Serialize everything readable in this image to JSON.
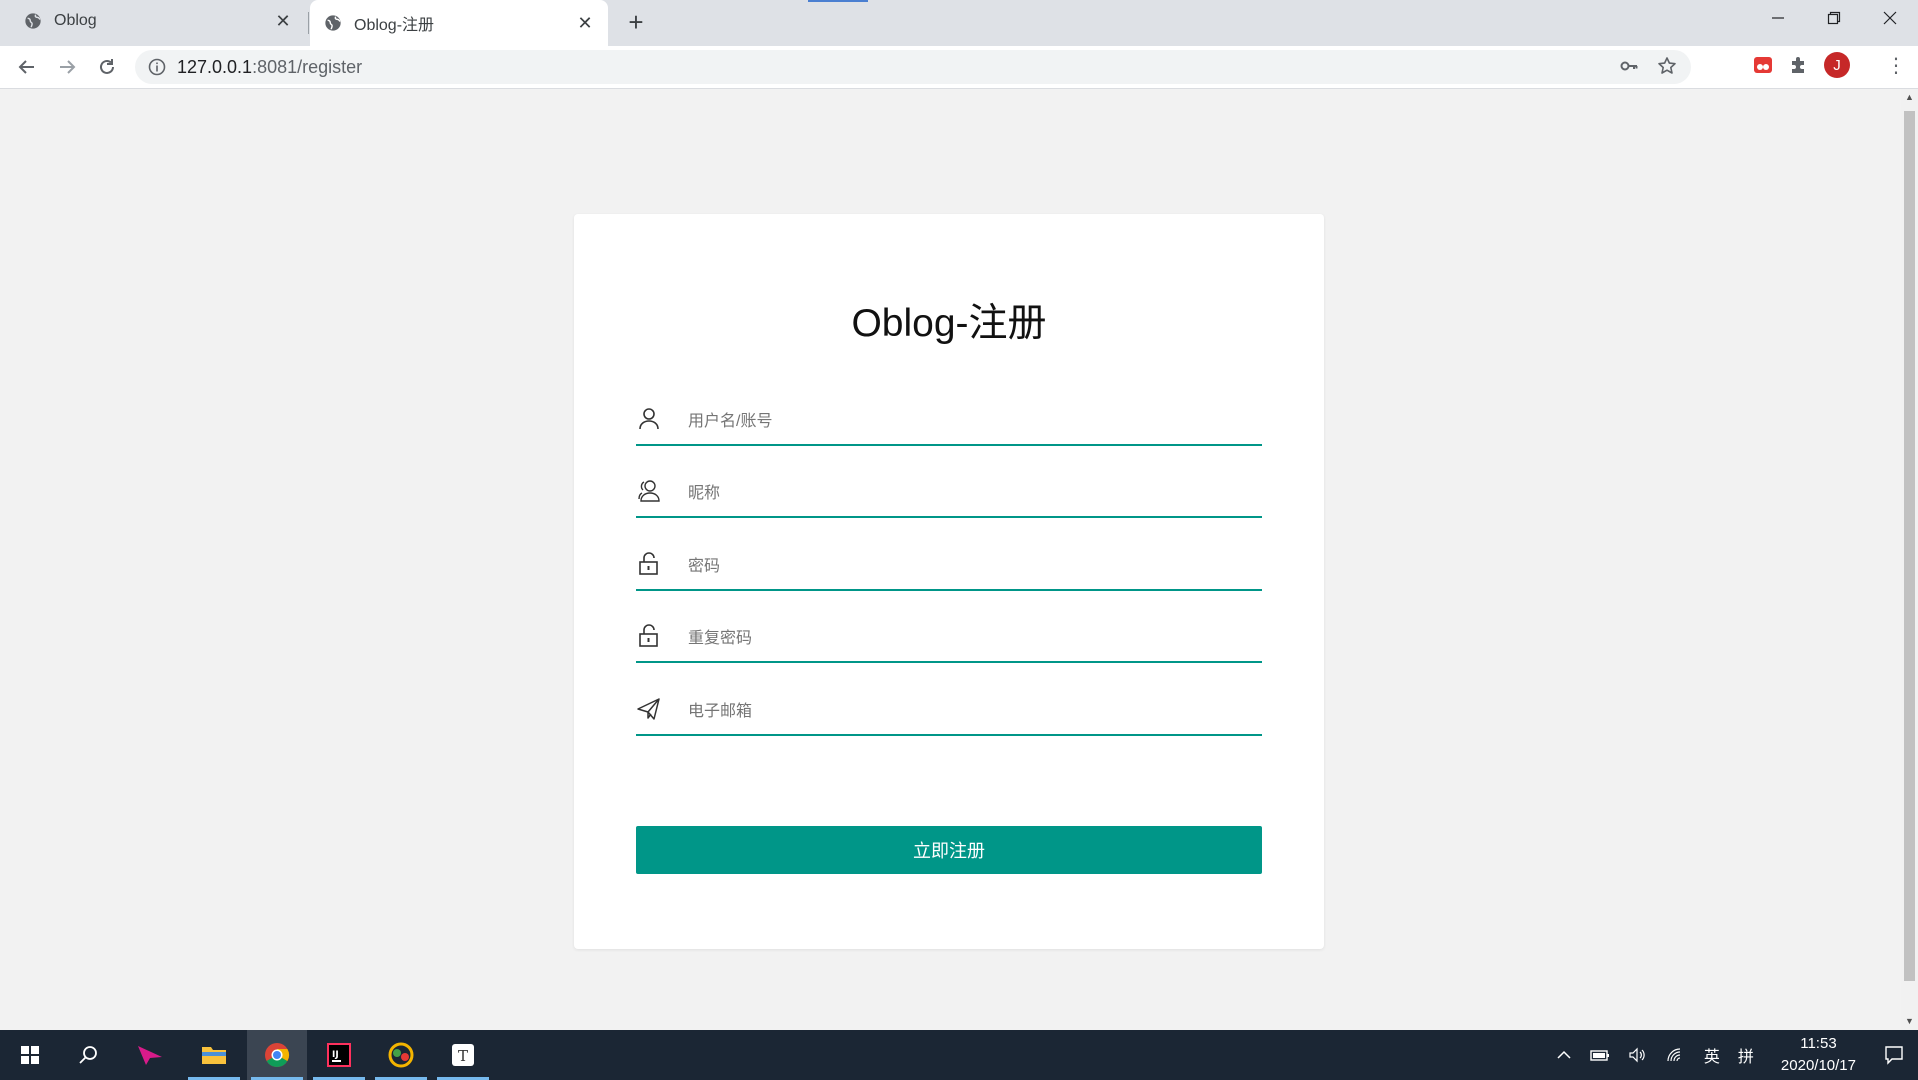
{
  "browser": {
    "tabs": [
      {
        "title": "Oblog",
        "active": false
      },
      {
        "title": "Oblog-注册",
        "active": true
      }
    ],
    "url_host": "127.0.0.1",
    "url_path": ":8081/register",
    "profile_initial": "J"
  },
  "page": {
    "title": "Oblog-注册",
    "fields": [
      {
        "icon": "user-icon",
        "placeholder": "用户名/账号"
      },
      {
        "icon": "users-icon",
        "placeholder": "昵称"
      },
      {
        "icon": "lock-icon",
        "placeholder": "密码"
      },
      {
        "icon": "lock-icon",
        "placeholder": "重复密码"
      },
      {
        "icon": "paper-plane-icon",
        "placeholder": "电子邮箱"
      }
    ],
    "submit_label": "立即注册",
    "accent_color": "#009688"
  },
  "taskbar": {
    "apps": [
      "start-icon",
      "search-icon",
      "kite-app-icon",
      "file-explorer-icon",
      "chrome-icon",
      "intellij-icon",
      "navicat-icon",
      "typora-icon"
    ],
    "ime_lang": "英",
    "ime_mode": "拼",
    "time": "11:53",
    "date": "2020/10/17"
  }
}
